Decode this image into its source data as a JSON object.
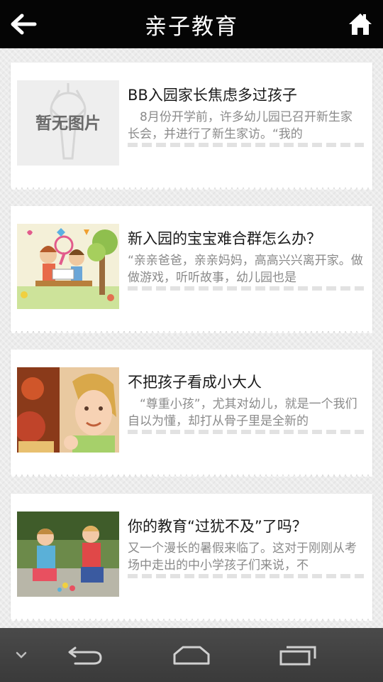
{
  "header": {
    "title": "亲子教育",
    "back_icon": "back-arrow-icon",
    "home_icon": "home-icon"
  },
  "articles": [
    {
      "title": "BB入园家长焦虑多过孩子",
      "summary": "　8月份开学前，许多幼儿园已召开新生家长会，并进行了新生家访。“我的",
      "image": {
        "type": "placeholder",
        "text": "暂无图片"
      }
    },
    {
      "title": "新入园的宝宝难合群怎么办？",
      "summary": "“亲亲爸爸，亲亲妈妈，高高兴兴离开家。做做游戏，听听故事，幼儿园也是",
      "image": {
        "type": "illustration",
        "subject": "children-reading-cartoon"
      }
    },
    {
      "title": "不把孩子看成小大人",
      "summary": "　“尊重小孩”，尤其对幼儿，就是一个我们自以为懂，却打从骨子里是全新的",
      "image": {
        "type": "photo",
        "subject": "little-girl-smiling"
      }
    },
    {
      "title": "你的教育“过犹不及”了吗？",
      "summary": "又一个漫长的暑假来临了。这对于刚刚从考场中走出的中小学孩子们来说，不",
      "image": {
        "type": "photo",
        "subject": "two-kids-playing"
      }
    }
  ],
  "navbar": {
    "icons": [
      "collapse-chevron-icon",
      "back-icon",
      "home-icon",
      "recent-apps-icon"
    ]
  },
  "colors": {
    "topbar": "#050505",
    "background": "#ececec",
    "card": "#ffffff",
    "title_text": "#1a1a1a",
    "summary_text": "#8a8a8a",
    "navbar": "#3f3f3f"
  }
}
